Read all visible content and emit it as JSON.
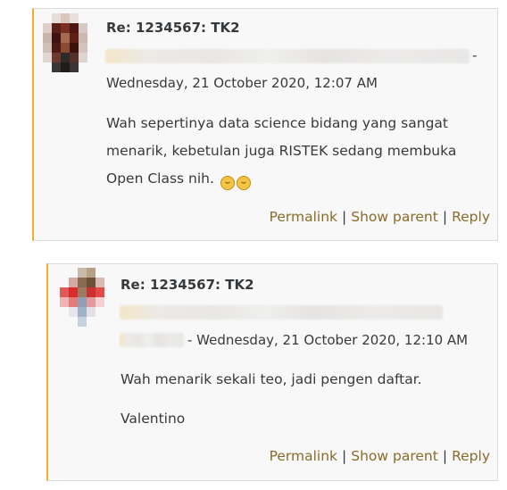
{
  "posts": [
    {
      "subject": "Re: 1234567: TK2",
      "date_line": "Wednesday, 21 October 2020, 12:07 AM",
      "separator": "-",
      "message": "Wah sepertinya data science bidang yang sangat menarik, kebetulan juga RISTEK sedang membuka Open Class nih.",
      "emojis": [
        "grinning-face-emoji",
        "grinning-face-emoji"
      ],
      "actions": {
        "permalink": "Permalink",
        "show_parent": "Show parent",
        "reply": "Reply",
        "divider": "|"
      }
    },
    {
      "subject": "Re: 1234567: TK2",
      "date_line": "- Wednesday, 21 October 2020, 12:10 AM",
      "message": "Wah menarik sekali teo, jadi pengen daftar.",
      "signature": "Valentino",
      "actions": {
        "permalink": "Permalink",
        "show_parent": "Show parent",
        "reply": "Reply",
        "divider": "|"
      }
    }
  ],
  "colors": {
    "accent_border": "#f0ad2e",
    "link": "#8a6b2a",
    "background": "#f8f8f8"
  }
}
